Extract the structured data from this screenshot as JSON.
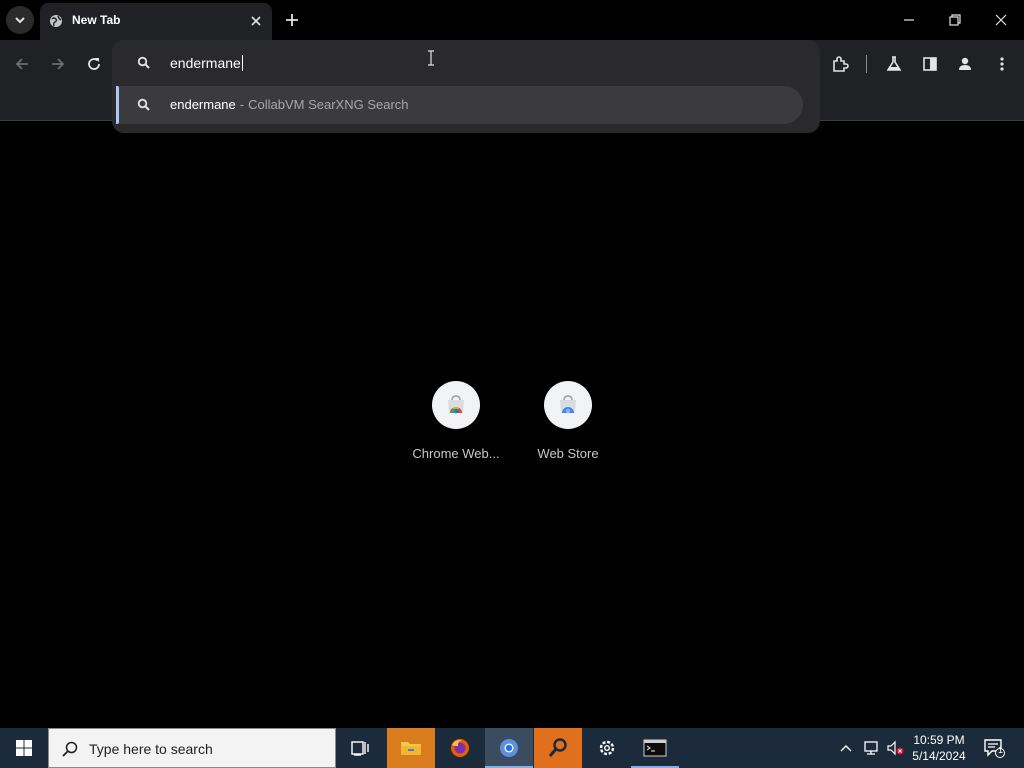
{
  "browser": {
    "tab": {
      "title": "New Tab",
      "favicon": "globe-icon"
    },
    "window_controls": [
      "minimize-icon",
      "restore-icon",
      "close-icon"
    ],
    "toolbar_icons": [
      "extensions-icon",
      "labs-flask-icon",
      "side-panel-icon",
      "profile-icon",
      "more-menu-icon"
    ]
  },
  "omnibox": {
    "input_value": "endermane",
    "suggestions": [
      {
        "query": "endermane",
        "separator": "-",
        "engine": "CollabVM SearXNG Search",
        "icon": "search-icon"
      }
    ]
  },
  "shortcuts": [
    {
      "label": "Chrome Web...",
      "icon": "chrome-web-store-icon"
    },
    {
      "label": "Web Store",
      "icon": "web-store-icon"
    }
  ],
  "taskbar": {
    "search_placeholder": "Type here to search",
    "apps": [
      "task-view-icon",
      "file-explorer-icon",
      "firefox-icon",
      "chrome-icon",
      "search-app-icon",
      "settings-icon",
      "terminal-icon"
    ],
    "active_app": "chrome-icon",
    "clock": {
      "time": "10:59 PM",
      "date": "5/14/2024"
    },
    "notification_count": "1"
  },
  "colors": {
    "accent": "#a8c7fa",
    "toolbar_bg": "#202124",
    "taskbar_bg": "#1c2b3b"
  }
}
